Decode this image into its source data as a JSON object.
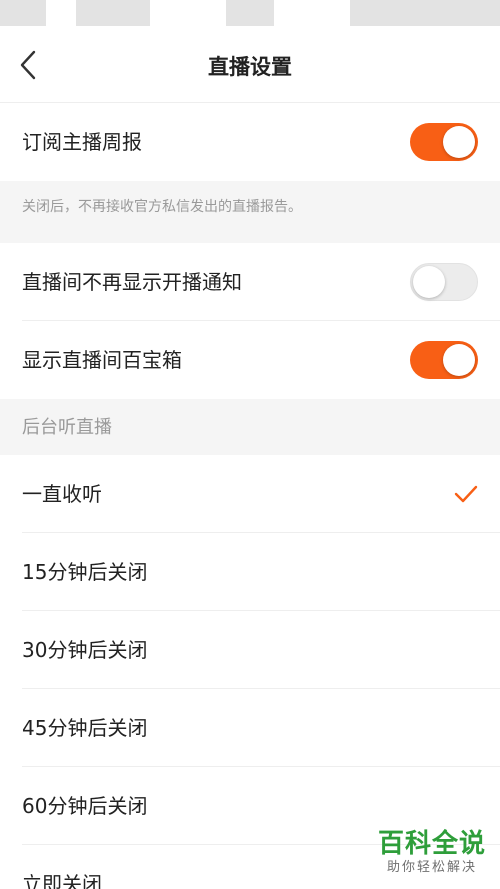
{
  "nav": {
    "title": "直播设置",
    "back_icon": "chevron-left-icon"
  },
  "colors": {
    "accent": "#f85f15",
    "toggle_off": "#ececec",
    "section_bg": "#f5f5f5",
    "hint_text": "#9a9a9a",
    "watermark": "#2e9e3a"
  },
  "settings": {
    "subscribe_weekly": {
      "label": "订阅主播周报",
      "enabled": true
    },
    "subscribe_note": "关闭后，不再接收官方私信发出的直播报告。",
    "hide_start_notice": {
      "label": "直播间不再显示开播通知",
      "enabled": false
    },
    "show_treasure_box": {
      "label": "显示直播间百宝箱",
      "enabled": true
    }
  },
  "background_listening": {
    "header": "后台听直播",
    "options": [
      {
        "label": "一直收听",
        "selected": true
      },
      {
        "label": "15分钟后关闭",
        "selected": false
      },
      {
        "label": "30分钟后关闭",
        "selected": false
      },
      {
        "label": "45分钟后关闭",
        "selected": false
      },
      {
        "label": "60分钟后关闭",
        "selected": false
      },
      {
        "label": "立即关闭",
        "selected": false
      }
    ]
  },
  "watermark": {
    "title": "百科全说",
    "subtitle": "助你轻松解决"
  }
}
